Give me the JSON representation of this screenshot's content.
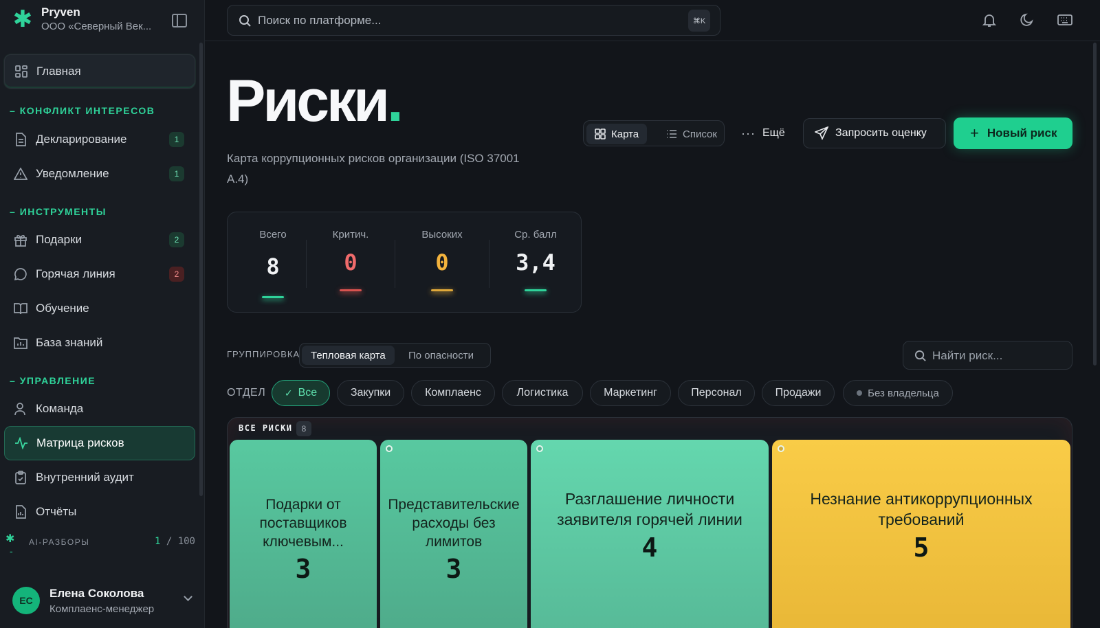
{
  "brand": {
    "name": "Pryven",
    "org": "ООО «Северный Век..."
  },
  "search": {
    "placeholder": "Поиск по платформе...",
    "shortcut": "⌘K"
  },
  "sidebar": {
    "home": "Главная",
    "sections": [
      {
        "title": "КОНФЛИКТ ИНТЕРЕСОВ",
        "items": [
          {
            "label": "Декларирование",
            "badge": "1"
          },
          {
            "label": "Уведомление",
            "badge": "1"
          }
        ]
      },
      {
        "title": "ИНСТРУМЕНТЫ",
        "items": [
          {
            "label": "Подарки",
            "badge": "2"
          },
          {
            "label": "Горячая линия",
            "badge": "2"
          },
          {
            "label": "Обучение"
          },
          {
            "label": "База знаний"
          }
        ]
      },
      {
        "title": "УПРАВЛЕНИЕ",
        "items": [
          {
            "label": "Команда"
          },
          {
            "label": "Матрица рисков"
          },
          {
            "label": "Внутренний аудит"
          },
          {
            "label": "Отчёты"
          }
        ]
      }
    ],
    "ai": {
      "label": "AI-РАЗБОРЫ",
      "used": "1",
      "sep": " / ",
      "limit": "100"
    },
    "user": {
      "initials": "ЕС",
      "name": "Елена Соколова",
      "role": "Комплаенс-менеджер"
    }
  },
  "header": {
    "title": "Риски",
    "title_dot": ".",
    "subtitle": "Карта коррупционных рисков организации (ISO 37001 A.4)",
    "view_map": "Карта",
    "view_list": "Список",
    "more": "Ещё",
    "request": "Запросить оценку",
    "new_risk": "Новый риск"
  },
  "stats": [
    {
      "label": "Всего",
      "value": "8",
      "color": "#f0f2f4",
      "bar": "#2fd39a"
    },
    {
      "label": "Критич.",
      "value": "0",
      "color": "#f06b6b",
      "bar": "#d9534f"
    },
    {
      "label": "Высоких",
      "value": "0",
      "color": "#f3b33d",
      "bar": "#e0a93a"
    },
    {
      "label": "Ср. балл",
      "value": "3,4",
      "color": "#f0f2f4",
      "bar": "#2fd39a"
    }
  ],
  "grouping": {
    "label": "ГРУППИРОВКА",
    "heatmap": "Тепловая карта",
    "by_severity": "По опасности",
    "find_placeholder": "Найти риск..."
  },
  "departments": {
    "label": "ОТДЕЛ",
    "chips": [
      "Все",
      "Закупки",
      "Комплаенс",
      "Логистика",
      "Маркетинг",
      "Персонал",
      "Продажи",
      "Без владельца"
    ]
  },
  "heatmap": {
    "tag": "ВСЕ РИСКИ",
    "count": "8",
    "cells": [
      {
        "title": "Подарки от поставщиков ключевым...",
        "score": "3"
      },
      {
        "title": "Представительские расходы без лимитов",
        "score": "3"
      },
      {
        "title": "Разглашение личности заявителя горячей линии",
        "score": "4"
      },
      {
        "title": "Незнание антикоррупционных требований",
        "score": "5"
      }
    ]
  }
}
